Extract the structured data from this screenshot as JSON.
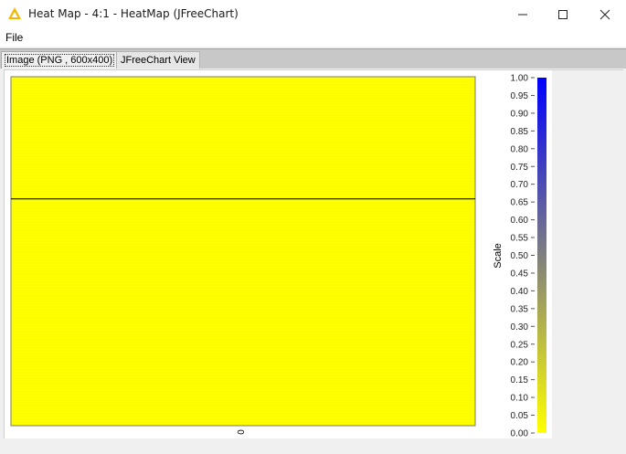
{
  "window": {
    "title": "Heat Map - 4:1 - HeatMap (JFreeChart)",
    "icon": "knime-triangle-icon",
    "controls": [
      "minimize",
      "maximize",
      "close"
    ]
  },
  "menubar": {
    "items": [
      {
        "label": "File"
      }
    ]
  },
  "tabs": [
    {
      "label": "Image (PNG , 600x400)",
      "selected": true
    },
    {
      "label": "JFreeChart View",
      "selected": false
    }
  ],
  "colors": {
    "heat_low": "#ffff00",
    "heat_high": "#0000ff",
    "marker_line": "#000080",
    "tab_strip": "#c8c8c8"
  },
  "chart_data": {
    "type": "heatmap",
    "x_categories": [
      "0"
    ],
    "cell_value_min": 0.0,
    "marker_fraction_from_bottom": 0.65,
    "colorbar": {
      "label": "Scale",
      "range": [
        0.0,
        1.0
      ],
      "low_color": "#ffff00",
      "high_color": "#0000ff",
      "ticks": [
        "0.00",
        "0.05",
        "0.10",
        "0.15",
        "0.20",
        "0.25",
        "0.30",
        "0.35",
        "0.40",
        "0.45",
        "0.50",
        "0.55",
        "0.60",
        "0.65",
        "0.70",
        "0.75",
        "0.80",
        "0.85",
        "0.90",
        "0.95",
        "1.00"
      ]
    },
    "grid": false,
    "legend_position": "right"
  }
}
